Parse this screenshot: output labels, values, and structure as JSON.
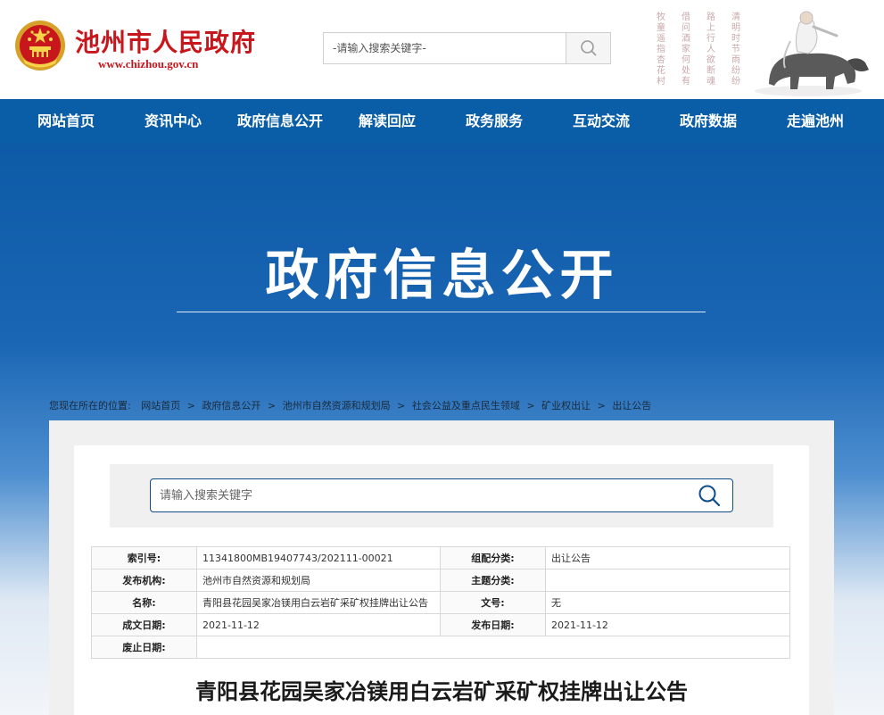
{
  "header": {
    "site_name": "池州市人民政府",
    "site_url": "www.chizhou.gov.cn",
    "search_placeholder": "-请输入搜索关键字-",
    "poem_columns": [
      "牧童遥指杏花村",
      "借问酒家何处有",
      "路上行人欲断魂",
      "清明时节雨纷纷"
    ]
  },
  "nav": {
    "items": [
      "网站首页",
      "资讯中心",
      "政府信息公开",
      "解读回应",
      "政务服务",
      "互动交流",
      "政府数据",
      "走遍池州"
    ]
  },
  "banner": {
    "title": "政府信息公开"
  },
  "breadcrumb": {
    "prefix": "您现在所在的位置:",
    "items": [
      "网站首页",
      "政府信息公开",
      "池州市自然资源和规划局",
      "社会公益及重点民生领域",
      "矿业权出让",
      "出让公告"
    ],
    "separator": ">"
  },
  "content": {
    "search_placeholder": "请输入搜索关键字",
    "meta": {
      "index_label": "索引号:",
      "index_value": "11341800MB19407743/202111-00021",
      "category_label": "组配分类:",
      "category_value": "出让公告",
      "org_label": "发布机构:",
      "org_value": "池州市自然资源和规划局",
      "topic_label": "主题分类:",
      "topic_value": "",
      "name_label": "名称:",
      "name_value": "青阳县花园吴家冶镁用白云岩矿采矿权挂牌出让公告",
      "docno_label": "文号:",
      "docno_value": "无",
      "created_label": "成文日期:",
      "created_value": "2021-11-12",
      "published_label": "发布日期:",
      "published_value": "2021-11-12",
      "expired_label": "废止日期:",
      "expired_value": ""
    },
    "article_title": "青阳县花园吴家冶镁用白云岩矿采矿权挂牌出让公告"
  },
  "colors": {
    "brand_red": "#c8161d",
    "nav_blue": "#0a5ea8",
    "search_border": "#0e4c8a"
  }
}
